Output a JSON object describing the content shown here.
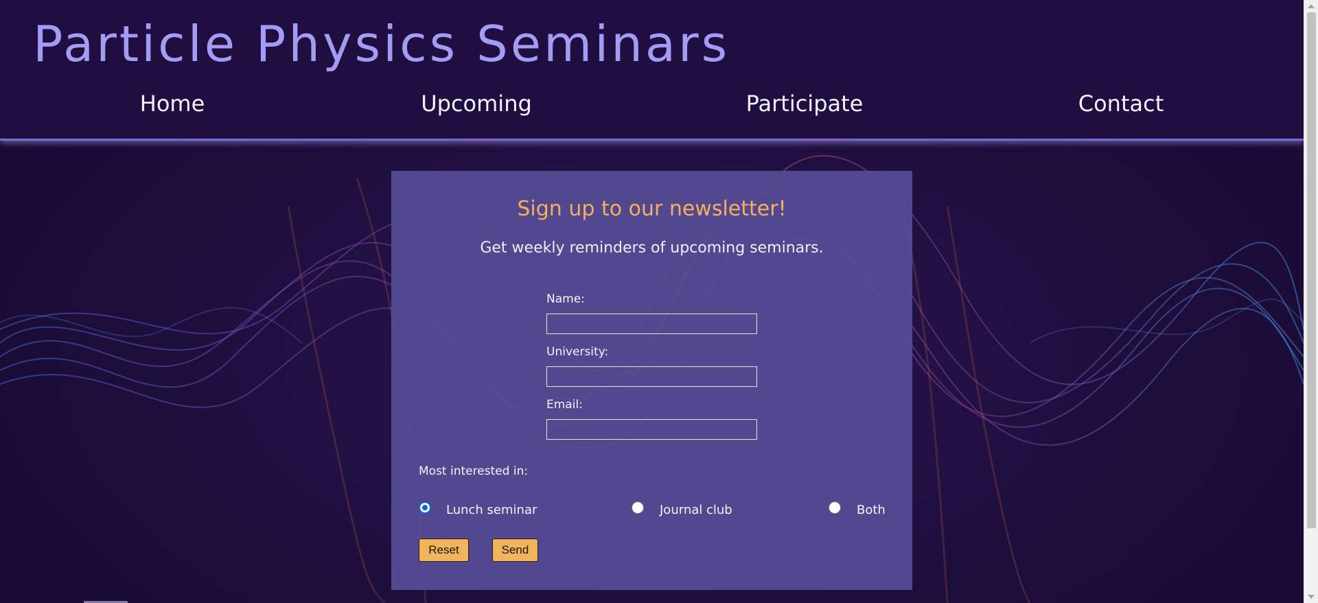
{
  "header": {
    "site_title": "Particle Physics Seminars",
    "nav": [
      {
        "label": "Home"
      },
      {
        "label": "Upcoming"
      },
      {
        "label": "Participate"
      },
      {
        "label": "Contact"
      }
    ]
  },
  "form": {
    "title": "Sign up to our newsletter!",
    "subtitle": "Get weekly reminders of upcoming seminars.",
    "fields": {
      "name": {
        "label": "Name:",
        "value": ""
      },
      "university": {
        "label": "University:",
        "value": ""
      },
      "email": {
        "label": "Email:",
        "value": ""
      }
    },
    "interest_label": "Most interested in:",
    "interest_options": [
      {
        "label": "Lunch seminar",
        "checked": true
      },
      {
        "label": "Journal club",
        "checked": false
      },
      {
        "label": "Both",
        "checked": false
      }
    ],
    "reset_label": "Reset",
    "send_label": "Send"
  },
  "colors": {
    "header_bg": "#200e40",
    "title": "#a39cf4",
    "card_bg": "#564c96",
    "heading_accent": "#f4b060",
    "button_bg": "#f0b45c",
    "radio_accent": "#0a66d8"
  }
}
